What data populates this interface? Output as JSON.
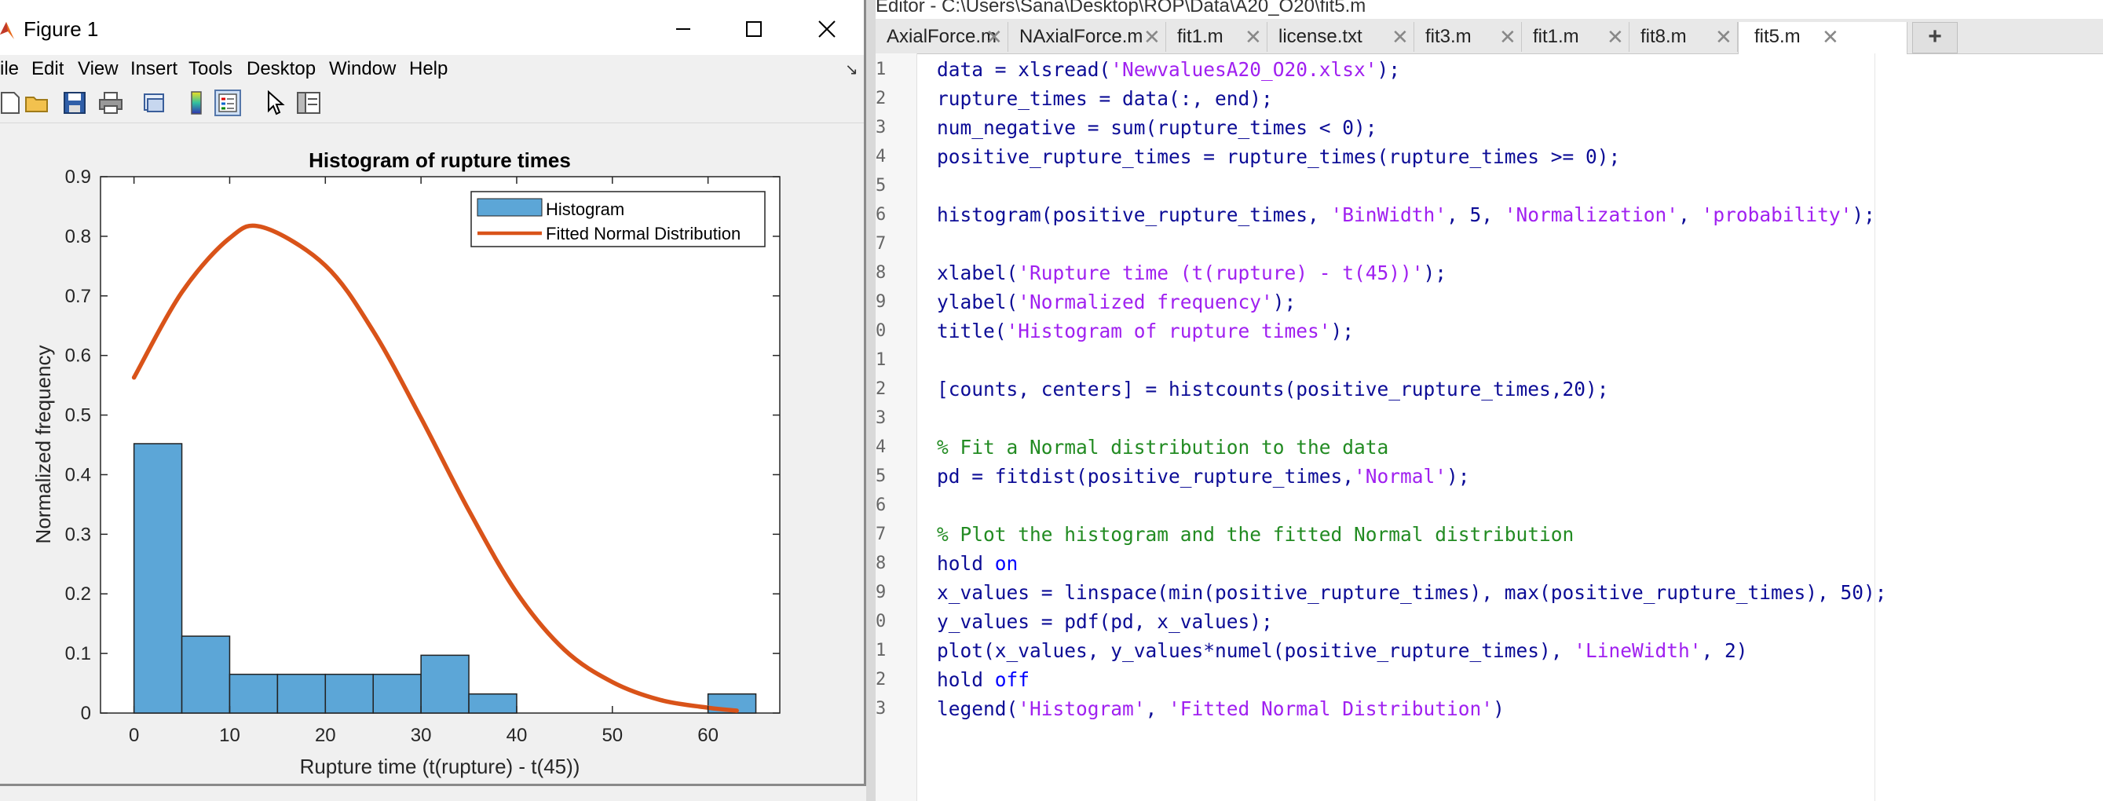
{
  "figure": {
    "title": "Figure 1",
    "menu": [
      "ile",
      "Edit",
      "View",
      "Insert",
      "Tools",
      "Desktop",
      "Window",
      "Help"
    ],
    "toolbar_icons": [
      "new-file-icon",
      "open-folder-icon",
      "save-icon",
      "print-icon",
      "link-icon",
      "colorbar-icon",
      "legend-icon",
      "pointer-icon",
      "property-editor-icon"
    ],
    "colors": {
      "bar_fill": "#5ca6d7",
      "bar_edge": "#222222",
      "curve": "#d95319"
    }
  },
  "chart_data": {
    "type": "bar",
    "title": "Histogram of rupture times",
    "xlabel": "Rupture time (t(rupture) - t(45))",
    "ylabel": "Normalized frequency",
    "xlim": [
      -3.5,
      67.5
    ],
    "ylim": [
      0,
      0.9
    ],
    "xticks": [
      0,
      10,
      20,
      30,
      40,
      50,
      60
    ],
    "yticks": [
      0,
      0.1,
      0.2,
      0.3,
      0.4,
      0.5,
      0.6,
      0.7,
      0.8,
      0.9
    ],
    "xtick_labels": [
      "0",
      "10",
      "20",
      "30",
      "40",
      "50",
      "60"
    ],
    "ytick_labels": [
      "0",
      "0.1",
      "0.2",
      "0.3",
      "0.4",
      "0.5",
      "0.6",
      "0.7",
      "0.8",
      "0.9"
    ],
    "bin_edges": [
      0,
      5,
      10,
      15,
      20,
      25,
      30,
      35,
      40,
      45,
      50,
      55,
      60,
      65
    ],
    "series": [
      {
        "name": "Histogram",
        "kind": "histogram",
        "values": [
          0.452,
          0.129,
          0.065,
          0.065,
          0.065,
          0.065,
          0.097,
          0.032,
          0,
          0,
          0,
          0,
          0.032
        ]
      },
      {
        "name": "Fitted Normal Distribution",
        "kind": "line",
        "x": [
          0,
          5,
          10,
          13.5,
          20,
          25,
          30,
          35,
          40,
          45,
          50,
          55,
          60,
          63
        ],
        "y": [
          0.563,
          0.706,
          0.797,
          0.815,
          0.751,
          0.641,
          0.495,
          0.34,
          0.202,
          0.106,
          0.052,
          0.022,
          0.009,
          0.004
        ]
      }
    ],
    "legend_position": "top-right",
    "grid": false
  },
  "editor": {
    "title": "Editor - C:\\Users\\Sana\\Desktop\\ROP\\Data\\A20_O20\\fit5.m",
    "tabs": [
      {
        "label": "AxialForce.m"
      },
      {
        "label": "NAxialForce.m"
      },
      {
        "label": "fit1.m"
      },
      {
        "label": "license.txt"
      },
      {
        "label": "fit3.m"
      },
      {
        "label": "fit1.m"
      },
      {
        "label": "fit8.m"
      },
      {
        "label": "fit5.m"
      }
    ],
    "add_tab_label": "+",
    "line_numbers": [
      "1",
      "2",
      "3",
      "4",
      "5",
      "6",
      "7",
      "8",
      "9",
      "0",
      "1",
      "2",
      "3",
      "4",
      "5",
      "6",
      "7",
      "8",
      "9",
      "0",
      "1",
      "2",
      "3"
    ],
    "code": [
      "data = xlsread('NewvaluesA20_O20.xlsx');",
      "rupture_times = data(:, end);",
      "num_negative = sum(rupture_times < 0);",
      "positive_rupture_times = rupture_times(rupture_times >= 0);",
      "",
      "histogram(positive_rupture_times, 'BinWidth', 5, 'Normalization', 'probability');",
      "",
      "xlabel('Rupture time (t(rupture) - t(45))');",
      "ylabel('Normalized frequency');",
      "title('Histogram of rupture times');",
      "",
      "[counts, centers] = histcounts(positive_rupture_times,20);",
      "",
      "% Fit a Normal distribution to the data",
      "pd = fitdist(positive_rupture_times,'Normal');",
      "",
      "% Plot the histogram and the fitted Normal distribution",
      "hold on",
      "x_values = linspace(min(positive_rupture_times), max(positive_rupture_times), 50);",
      "y_values = pdf(pd, x_values);",
      "plot(x_values, y_values*numel(positive_rupture_times), 'LineWidth', 2)",
      "hold off",
      "legend('Histogram', 'Fitted Normal Distribution')"
    ]
  }
}
